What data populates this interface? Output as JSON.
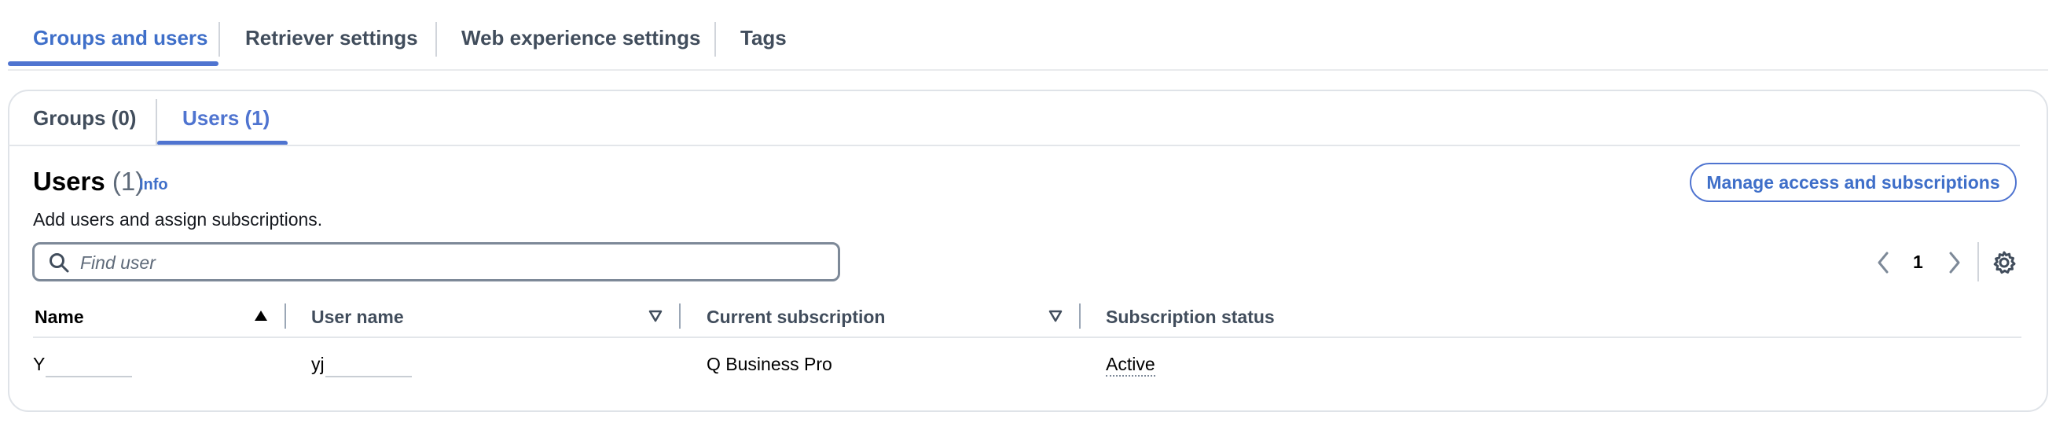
{
  "top_tabs": [
    {
      "label": "Groups and users",
      "active": true
    },
    {
      "label": "Retriever settings",
      "active": false
    },
    {
      "label": "Web experience settings",
      "active": false
    },
    {
      "label": "Tags",
      "active": false
    }
  ],
  "inner_tabs": [
    {
      "label": "Groups (0)",
      "active": false
    },
    {
      "label": "Users (1)",
      "active": true
    }
  ],
  "section": {
    "title": "Users",
    "count": "(1)",
    "info_link": "Info",
    "description": "Add users and assign subscriptions.",
    "manage_button": "Manage access and subscriptions"
  },
  "search": {
    "placeholder": "Find user",
    "value": ""
  },
  "pagination": {
    "current_page": "1"
  },
  "table": {
    "columns": [
      "Name",
      "User name",
      "Current subscription",
      "Subscription status"
    ],
    "sorted_column": "Name",
    "sort_direction": "ascending",
    "rows": [
      {
        "name": "Y",
        "user_name": "yj",
        "subscription": "Q Business Pro",
        "status": "Active"
      }
    ]
  },
  "colors": {
    "accent": "#4f74d0",
    "text": "#16191f",
    "muted": "#414d5c",
    "border": "#dfe3e8"
  },
  "icons": [
    "search-icon",
    "chevron-left-icon",
    "chevron-right-icon",
    "gear-icon",
    "sort-ascending-icon",
    "sort-icon"
  ]
}
